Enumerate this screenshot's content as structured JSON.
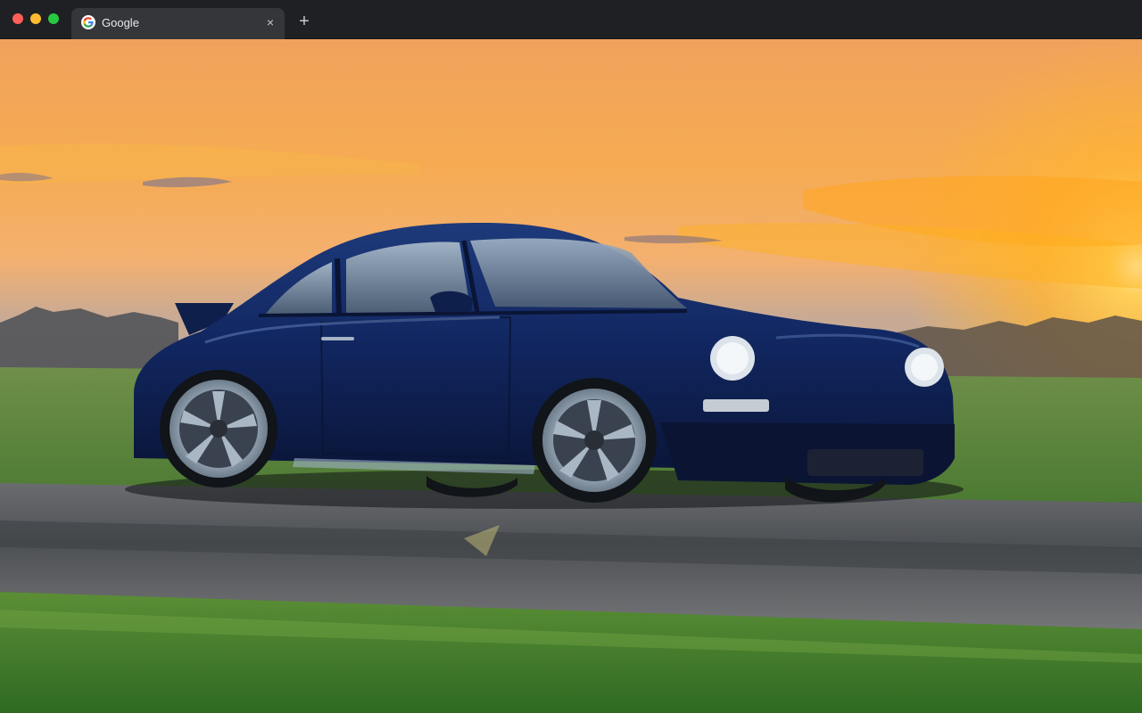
{
  "window": {
    "traffic_lights": {
      "close_color": "#fe5f57",
      "minimize_color": "#febc2e",
      "maximize_color": "#28c840"
    }
  },
  "tabs": [
    {
      "title": "Google",
      "favicon": "google-g-icon",
      "active": true,
      "close_glyph": "×"
    }
  ],
  "new_tab_glyph": "+",
  "page": {
    "background_image": "dark-blue-sports-car-at-sunset-on-runway",
    "colors": {
      "sky_top": "#f2a35a",
      "sky_glow": "#ffb830",
      "grass": "#5a8a3a",
      "tarmac": "#5b5e62",
      "car_body": "#10214f"
    }
  }
}
